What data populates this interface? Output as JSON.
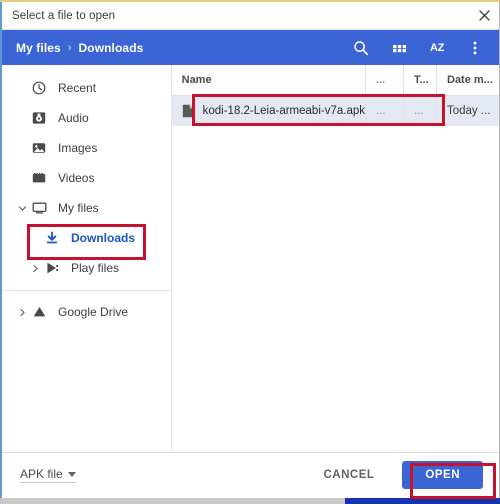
{
  "window": {
    "title": "Select a file to open",
    "close_icon": "close-icon"
  },
  "toolbar": {
    "breadcrumb": [
      {
        "label": "My files"
      },
      {
        "label": "Downloads"
      }
    ],
    "separator": "›",
    "actions": [
      {
        "name": "search-icon",
        "label": ""
      },
      {
        "name": "grid-view-icon",
        "label": ""
      },
      {
        "name": "sort-az-icon",
        "label": "AZ"
      },
      {
        "name": "more-options-icon",
        "label": ""
      }
    ],
    "accent_color": "#3b64d4"
  },
  "sidebar": {
    "items": [
      {
        "label": "Recent",
        "icon": "clock-icon",
        "twisty": "",
        "level": 0,
        "selected": false
      },
      {
        "label": "Audio",
        "icon": "audio-icon",
        "twisty": "",
        "level": 0,
        "selected": false
      },
      {
        "label": "Images",
        "icon": "image-icon",
        "twisty": "",
        "level": 0,
        "selected": false
      },
      {
        "label": "Videos",
        "icon": "video-icon",
        "twisty": "",
        "level": 0,
        "selected": false
      },
      {
        "label": "My files",
        "icon": "computer-icon",
        "twisty": "⌄",
        "level": 0,
        "selected": false
      },
      {
        "label": "Downloads",
        "icon": "download-icon",
        "twisty": "",
        "level": 1,
        "selected": true
      },
      {
        "label": "Play files",
        "icon": "play-store-icon",
        "twisty": "›",
        "level": 1,
        "selected": false
      },
      {
        "label": "Google Drive",
        "icon": "google-drive-icon",
        "twisty": "›",
        "level": 0,
        "selected": false
      }
    ]
  },
  "file_list": {
    "columns": {
      "name": "Name",
      "size": "...",
      "type": "T...",
      "date": "Date m..."
    },
    "rows": [
      {
        "name": "kodi-18.2-Leia-armeabi-v7a.apk",
        "icon": "file-icon",
        "size": "...",
        "type": "...",
        "date": "Today ...",
        "selected": true
      }
    ]
  },
  "footer": {
    "file_type": "APK file",
    "cancel_label": "CANCEL",
    "open_label": "OPEN"
  },
  "annotations": {
    "highlight_color": "#c4122f",
    "boxes": [
      {
        "name": "file-row-highlight"
      },
      {
        "name": "downloads-highlight"
      },
      {
        "name": "open-button-highlight"
      }
    ]
  }
}
